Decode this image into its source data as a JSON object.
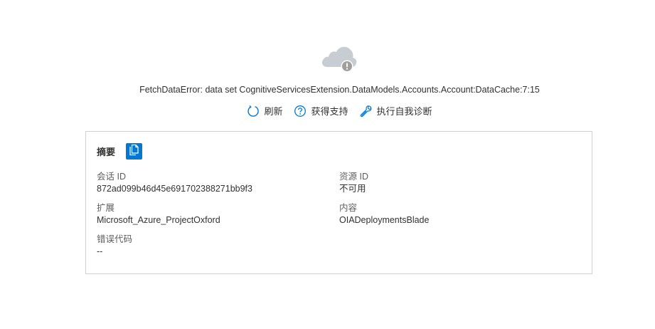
{
  "error": {
    "message": "FetchDataError: data set CognitiveServicesExtension.DataModels.Accounts.Account:DataCache:7:15"
  },
  "actions": {
    "refresh_label": "刷新",
    "support_label": "获得支持",
    "diagnose_label": "执行自我诊断"
  },
  "summary": {
    "title": "摘要",
    "fields": {
      "session_label": "会话 ID",
      "session_value": "872ad099b46d45e691702388271bb9f3",
      "resource_label": "资源 ID",
      "resource_value": "不可用",
      "extension_label": "扩展",
      "extension_value": "Microsoft_Azure_ProjectOxford",
      "content_label": "内容",
      "content_value": "OIADeploymentsBlade",
      "error_code_label": "错误代码",
      "error_code_value": "--"
    }
  },
  "colors": {
    "accent": "#0078d4",
    "cloud": "#c8cdd3",
    "border": "#d2d0ce"
  },
  "icons": [
    "cloud-error-icon",
    "refresh-icon",
    "help-icon",
    "wrench-icon",
    "copy-icon"
  ]
}
